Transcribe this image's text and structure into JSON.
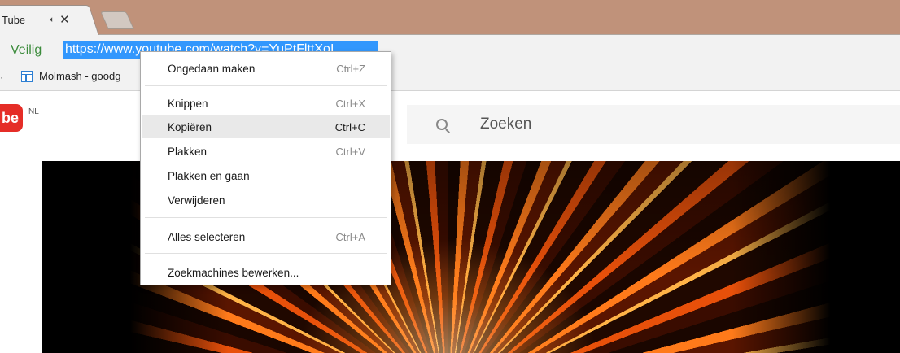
{
  "tab": {
    "title": "Tube",
    "audio_icon": "speaker-icon",
    "close_icon": "close-icon"
  },
  "omnibox": {
    "secure_label": "Veilig",
    "url": "https://www.youtube.com/watch?v=YuPtFlttXoI"
  },
  "bookmarks": {
    "items": [
      {
        "label": "Molmash - goodg",
        "icon": "page-icon"
      }
    ]
  },
  "youtube": {
    "logo_text": "be",
    "country": "NL",
    "search_placeholder": "Zoeken"
  },
  "context_menu": {
    "items": [
      {
        "label": "Ongedaan maken",
        "shortcut": "Ctrl+Z"
      },
      {
        "label": "Knippen",
        "shortcut": "Ctrl+X"
      },
      {
        "label": "Kopiëren",
        "shortcut": "Ctrl+C",
        "highlighted": true
      },
      {
        "label": "Plakken",
        "shortcut": "Ctrl+V"
      },
      {
        "label": "Plakken en gaan",
        "shortcut": ""
      },
      {
        "label": "Verwijderen",
        "shortcut": ""
      },
      {
        "label": "Alles selecteren",
        "shortcut": "Ctrl+A"
      },
      {
        "label": "Zoekmachines bewerken...",
        "shortcut": ""
      }
    ]
  },
  "colors": {
    "tabstrip": "#c0927a",
    "secure_green": "#3b8b3b",
    "url_selection": "#3297fd",
    "youtube_red": "#e52d27"
  }
}
